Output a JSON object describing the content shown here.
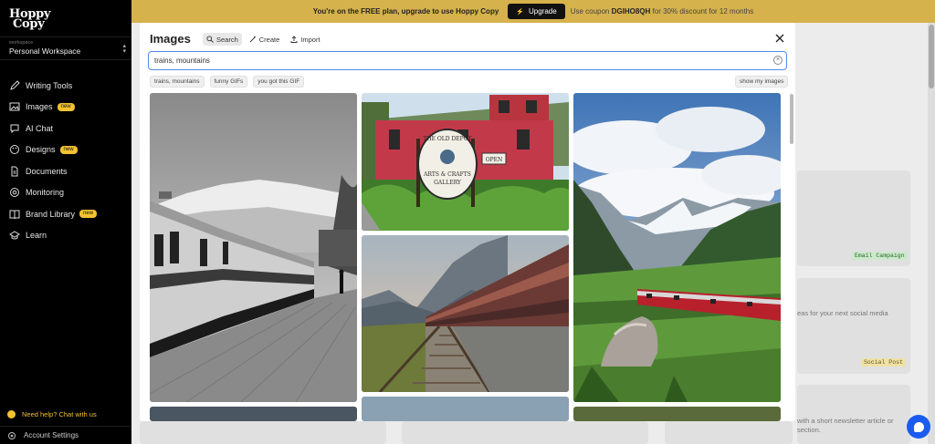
{
  "sidebar": {
    "logo_line1": "Hoppy",
    "logo_line2": "Copy",
    "workspace_label": "workspace",
    "workspace_name": "Personal Workspace",
    "items": [
      {
        "label": "Writing Tools",
        "icon": "pen-icon",
        "badge": ""
      },
      {
        "label": "Images",
        "icon": "image-icon",
        "badge": "new"
      },
      {
        "label": "AI Chat",
        "icon": "chat-icon",
        "badge": ""
      },
      {
        "label": "Designs",
        "icon": "palette-icon",
        "badge": "new"
      },
      {
        "label": "Documents",
        "icon": "document-icon",
        "badge": ""
      },
      {
        "label": "Monitoring",
        "icon": "at-icon",
        "badge": ""
      },
      {
        "label": "Brand Library",
        "icon": "book-icon",
        "badge": "new"
      },
      {
        "label": "Learn",
        "icon": "graduation-cap-icon",
        "badge": ""
      }
    ],
    "help": "Need help? Chat with us",
    "account": "Account Settings"
  },
  "banner": {
    "text": "You're on the FREE plan, upgrade to use Hoppy Copy",
    "button": "Upgrade",
    "coupon_prefix": "Use coupon",
    "coupon_code": "DGIHO8QH",
    "coupon_suffix": "for 30% discount for 12 months"
  },
  "background": {
    "tags": [
      "Email Campaign",
      "Social Post"
    ],
    "texts": [
      "eas for your next social media",
      "with a short newsletter article or",
      "section."
    ]
  },
  "modal": {
    "title": "Images",
    "tabs": [
      {
        "label": "Search",
        "icon": "search-icon"
      },
      {
        "label": "Create",
        "icon": "wand-icon"
      },
      {
        "label": "Import",
        "icon": "upload-icon"
      }
    ],
    "search_value": "trains, mountains",
    "chips": [
      "trains, mountains",
      "funny GIFs",
      "you got this GIF"
    ],
    "show_my_images": "show my images",
    "images": [
      "black-and-white-train-platform",
      "red-caboose-old-depot",
      "motion-blur-train-on-tracks",
      "red-train-alpine-mountains"
    ],
    "image_sign_lines": [
      "THE OLD DEPOT",
      "ARTS & CRAFTS",
      "GALLERY",
      "OPEN"
    ]
  },
  "colors": {
    "accent_yellow": "#d6b24c",
    "badge_yellow": "#f2c230",
    "focus_blue": "#4e8fe6",
    "chat_blue": "#1a5cf0"
  }
}
